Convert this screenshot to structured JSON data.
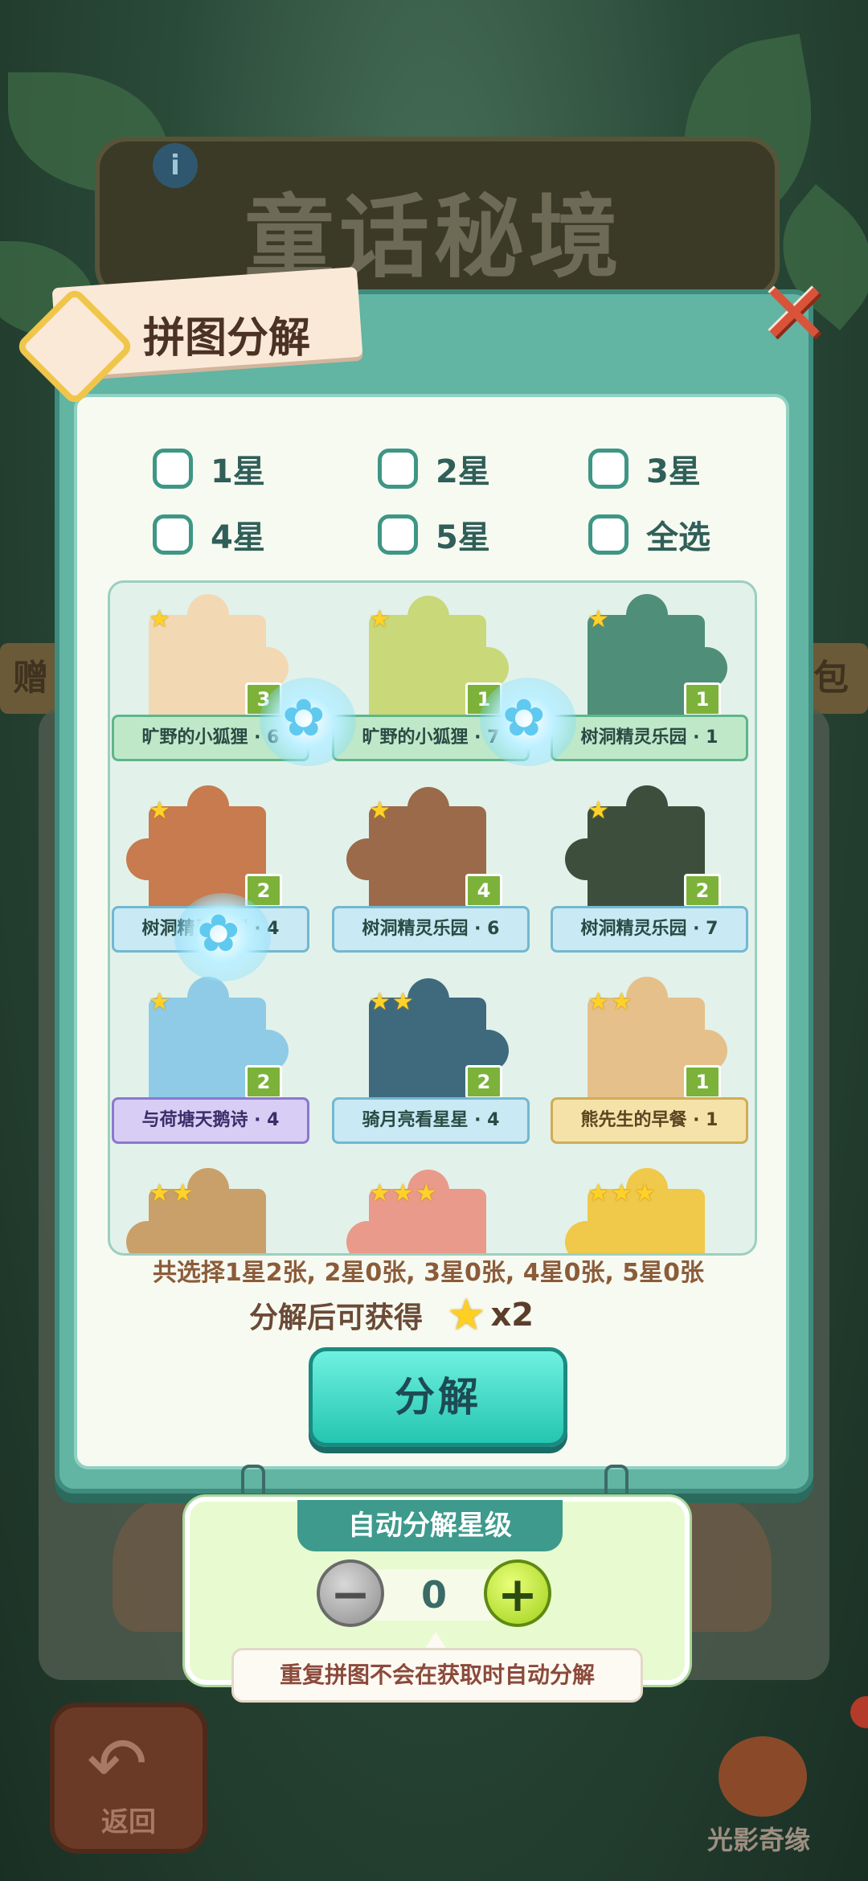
{
  "background": {
    "title": "童话秘境",
    "info_icon": "i",
    "strip_left_text": "赠",
    "strip_right_text": "包",
    "back_label": "返回",
    "logo_text": "光影奇缘"
  },
  "dialog": {
    "title": "拼图分解",
    "close_icon": "close-icon",
    "filters": [
      {
        "label": "1星",
        "checked": false
      },
      {
        "label": "2星",
        "checked": false
      },
      {
        "label": "3星",
        "checked": false
      },
      {
        "label": "4星",
        "checked": false
      },
      {
        "label": "5星",
        "checked": false
      },
      {
        "label": "全选",
        "checked": false
      }
    ],
    "pieces": [
      {
        "name": "旷野的小狐狸 · 6",
        "stars": 1,
        "count": "3",
        "ribbon": "green",
        "color": "#f3d8b4"
      },
      {
        "name": "旷野的小狐狸 · 7",
        "stars": 1,
        "count": "1",
        "ribbon": "green",
        "color": "#c9d878"
      },
      {
        "name": "树洞精灵乐园 · 1",
        "stars": 1,
        "count": "1",
        "ribbon": "green",
        "color": "#4f8f7a"
      },
      {
        "name": "树洞精灵乐园 · 4",
        "stars": 1,
        "count": "2",
        "ribbon": "blue",
        "color": "#c77b4e"
      },
      {
        "name": "树洞精灵乐园 · 6",
        "stars": 1,
        "count": "4",
        "ribbon": "blue",
        "color": "#9b6a4a"
      },
      {
        "name": "树洞精灵乐园 · 7",
        "stars": 1,
        "count": "2",
        "ribbon": "blue",
        "color": "#3d4f3c"
      },
      {
        "name": "与荷塘天鹅诗 · 4",
        "stars": 1,
        "count": "2",
        "ribbon": "purple",
        "color": "#8fcbe6"
      },
      {
        "name": "骑月亮看星星 · 4",
        "stars": 2,
        "count": "2",
        "ribbon": "blue",
        "color": "#3f6a7e"
      },
      {
        "name": "熊先生的早餐 · 1",
        "stars": 2,
        "count": "1",
        "ribbon": "gold",
        "color": "#e6c08a"
      },
      {
        "name": "",
        "stars": 2,
        "count": "",
        "ribbon": "none",
        "color": "#c9a06a"
      },
      {
        "name": "",
        "stars": 3,
        "count": "",
        "ribbon": "none",
        "color": "#e99a8a"
      },
      {
        "name": "",
        "stars": 3,
        "count": "",
        "ribbon": "none",
        "color": "#f0c84a"
      }
    ],
    "summary": "共选择1星2张, 2星0张, 3星0张, 4星0张, 5星0张",
    "reward_label": "分解后可获得",
    "reward_icon": "star-icon",
    "reward_multiplier": "x2",
    "decompose_button": "分解"
  },
  "auto_panel": {
    "title": "自动分解星级",
    "value": "0",
    "minus_icon": "minus-icon",
    "plus_icon": "plus-icon",
    "hint": "重复拼图不会在获取时自动分解"
  }
}
